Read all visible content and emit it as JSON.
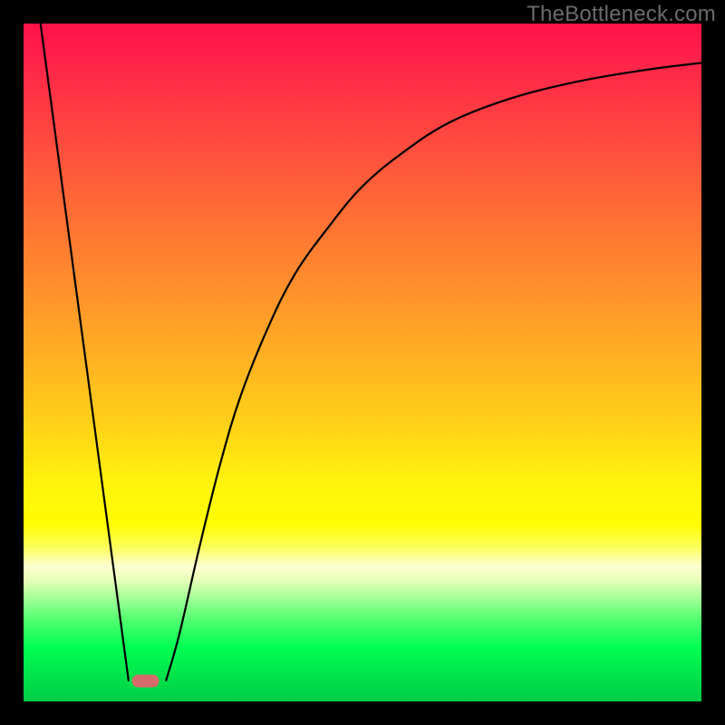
{
  "watermark": "TheBottleneck.com",
  "colors": {
    "frame": "#000000",
    "gradient_top": "#ff1248",
    "gradient_bottom": "#00cc46",
    "curve_stroke": "#000000",
    "marker_fill": "#d76b6b"
  },
  "chart_data": {
    "type": "line",
    "title": "",
    "xlabel": "",
    "ylabel": "",
    "xlim": [
      0,
      100
    ],
    "ylim": [
      0,
      100
    ],
    "grid": false,
    "legend": false,
    "series": [
      {
        "name": "left-descent",
        "x": [
          2.5,
          15.5
        ],
        "y": [
          100,
          3
        ]
      },
      {
        "name": "right-curve",
        "x": [
          21,
          23,
          26,
          29,
          32,
          36,
          40,
          45,
          50,
          56,
          63,
          72,
          82,
          92,
          100
        ],
        "y": [
          3,
          10,
          23,
          35,
          45,
          55,
          63,
          70,
          76,
          81,
          85.5,
          89,
          91.5,
          93.2,
          94.2
        ]
      }
    ],
    "marker": {
      "x": 18,
      "y": 3,
      "shape": "rounded-pill"
    },
    "notes": "Values are estimated from pixel positions against the inner plot area. The y-axis is oriented so 0=bottom, 100=top (bottom corresponds to green)."
  }
}
